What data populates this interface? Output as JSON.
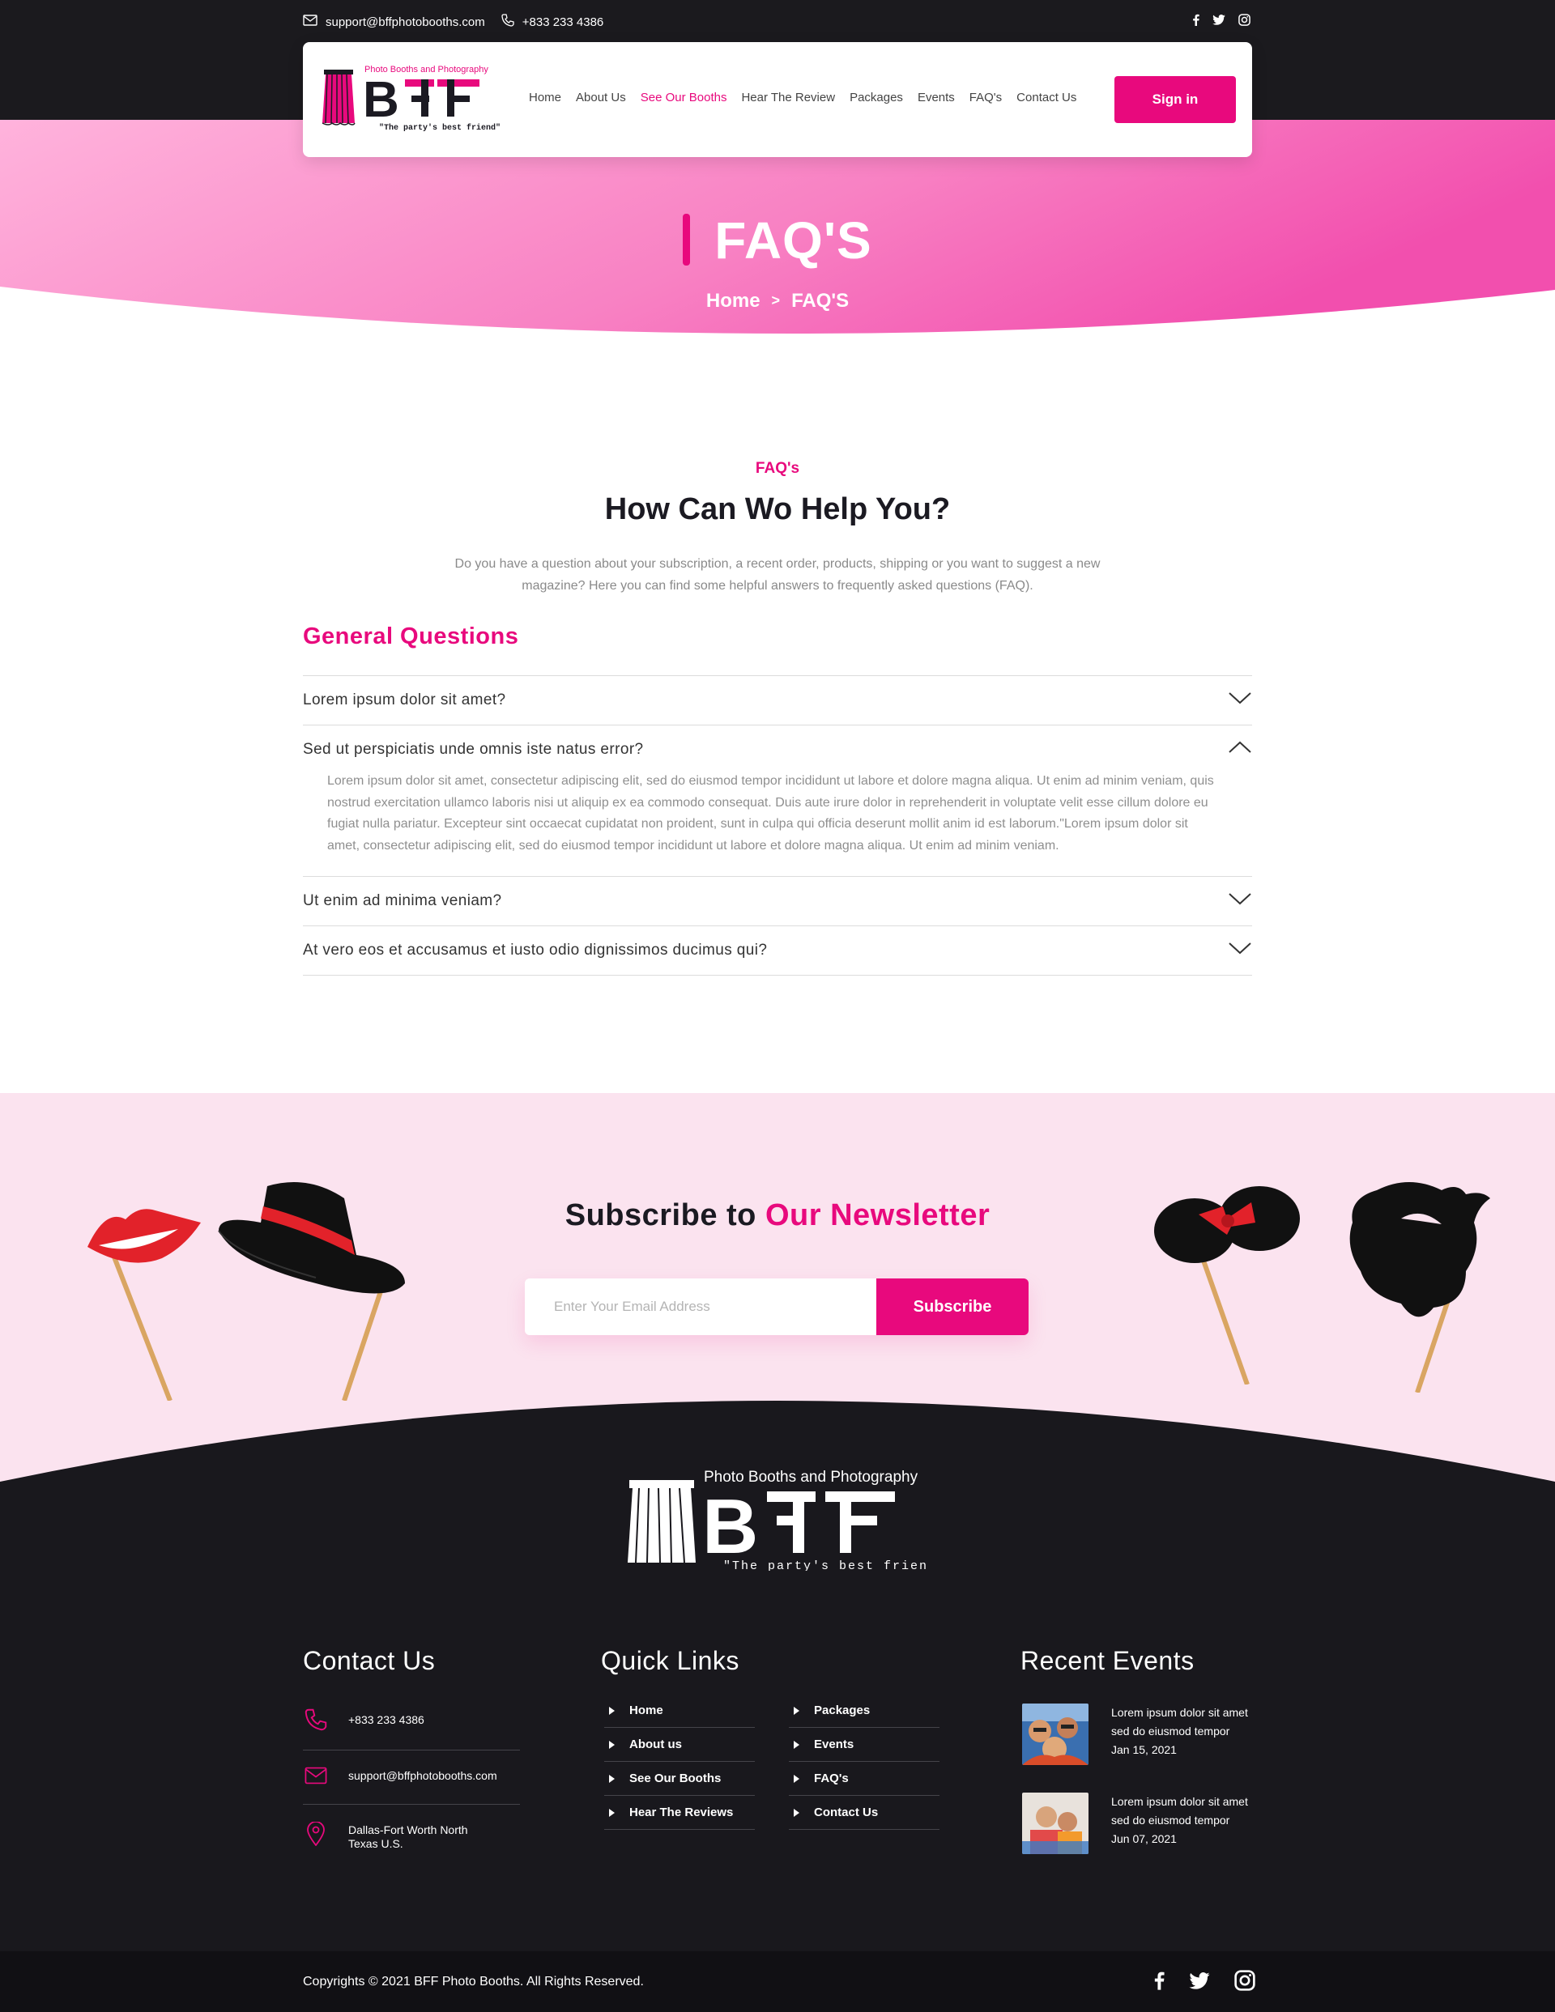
{
  "topbar": {
    "email": "support@bffphotobooths.com",
    "phone": "+833 233 4386",
    "social_icons": [
      "facebook-icon",
      "twitter-icon",
      "instagram-icon"
    ]
  },
  "brand": {
    "logo_tagline": "Photo Booths and Photography",
    "logo_letters": "BFF",
    "logo_slogan": "\"The party's best friend\"",
    "accent_color": "#e8097d",
    "dark_color": "#1b1a1e",
    "hero_gradient": [
      "#ffb0da",
      "#f550b0"
    ]
  },
  "nav": {
    "items": [
      {
        "label": "Home",
        "active": false
      },
      {
        "label": "About Us",
        "active": false
      },
      {
        "label": "See Our Booths",
        "active": true
      },
      {
        "label": "Hear The Review",
        "active": false
      },
      {
        "label": "Packages",
        "active": false
      },
      {
        "label": "Events",
        "active": false
      },
      {
        "label": "FAQ's",
        "active": false
      },
      {
        "label": "Contact Us",
        "active": false
      }
    ],
    "signin_label": "Sign in"
  },
  "hero": {
    "title": "FAQ'S",
    "breadcrumb": {
      "home": "Home",
      "separator": ">",
      "current": "FAQ'S"
    }
  },
  "faq": {
    "eyebrow": "FAQ's",
    "heading": "How Can Wo Help You?",
    "intro": "Do you have a question about your subscription, a recent order, products, shipping or you want to suggest a new magazine? Here you can find some helpful answers to frequently asked questions (FAQ).",
    "section_title": "General Questions",
    "items": [
      {
        "question": "Lorem ipsum dolor sit amet?",
        "expanded": false,
        "answer": ""
      },
      {
        "question": "Sed ut perspiciatis unde omnis iste natus error?",
        "expanded": true,
        "answer": "Lorem ipsum dolor sit amet, consectetur adipiscing elit, sed do eiusmod tempor incididunt ut labore et dolore magna aliqua. Ut enim ad minim veniam, quis nostrud exercitation ullamco laboris nisi ut aliquip ex ea commodo consequat. Duis aute irure dolor in reprehenderit in voluptate velit esse cillum dolore eu fugiat nulla pariatur. Excepteur sint occaecat cupidatat non proident, sunt in culpa qui officia deserunt mollit anim id est laborum.\"Lorem ipsum dolor sit amet, consectetur adipiscing elit, sed do eiusmod tempor incididunt ut labore et dolore magna aliqua. Ut enim ad minim veniam."
      },
      {
        "question": "Ut enim ad minima veniam?",
        "expanded": false,
        "answer": ""
      },
      {
        "question": "At vero eos et accusamus et iusto odio dignissimos ducimus qui?",
        "expanded": false,
        "answer": ""
      }
    ]
  },
  "newsletter": {
    "title_part1": "Subscribe to",
    "title_part2": "Our Newsletter",
    "placeholder": "Enter Your Email Address",
    "button_label": "Subscribe",
    "background_color": "#fbe3ef"
  },
  "footer": {
    "contact": {
      "title": "Contact Us",
      "phone": "+833 233 4386",
      "email": "support@bffphotobooths.com",
      "address_line1": "Dallas-Fort Worth North",
      "address_line2": "Texas U.S."
    },
    "quick_links": {
      "title": "Quick Links",
      "col1": [
        "Home",
        "About us",
        "See Our Booths",
        "Hear The Reviews"
      ],
      "col2": [
        "Packages",
        "Events",
        "FAQ's",
        "Contact Us"
      ]
    },
    "recent_events": {
      "title": "Recent Events",
      "items": [
        {
          "line1": "Lorem ipsum dolor sit amet",
          "line2": "sed do eiusmod tempor",
          "date": "Jan 15, 2021"
        },
        {
          "line1": "Lorem ipsum dolor sit amet",
          "line2": "sed do eiusmod tempor",
          "date": "Jun 07, 2021"
        }
      ]
    }
  },
  "copyright": {
    "text": "Copyrights © 2021 BFF Photo Booths. All Rights Reserved.",
    "social_icons": [
      "facebook-icon",
      "twitter-icon",
      "instagram-icon"
    ]
  }
}
